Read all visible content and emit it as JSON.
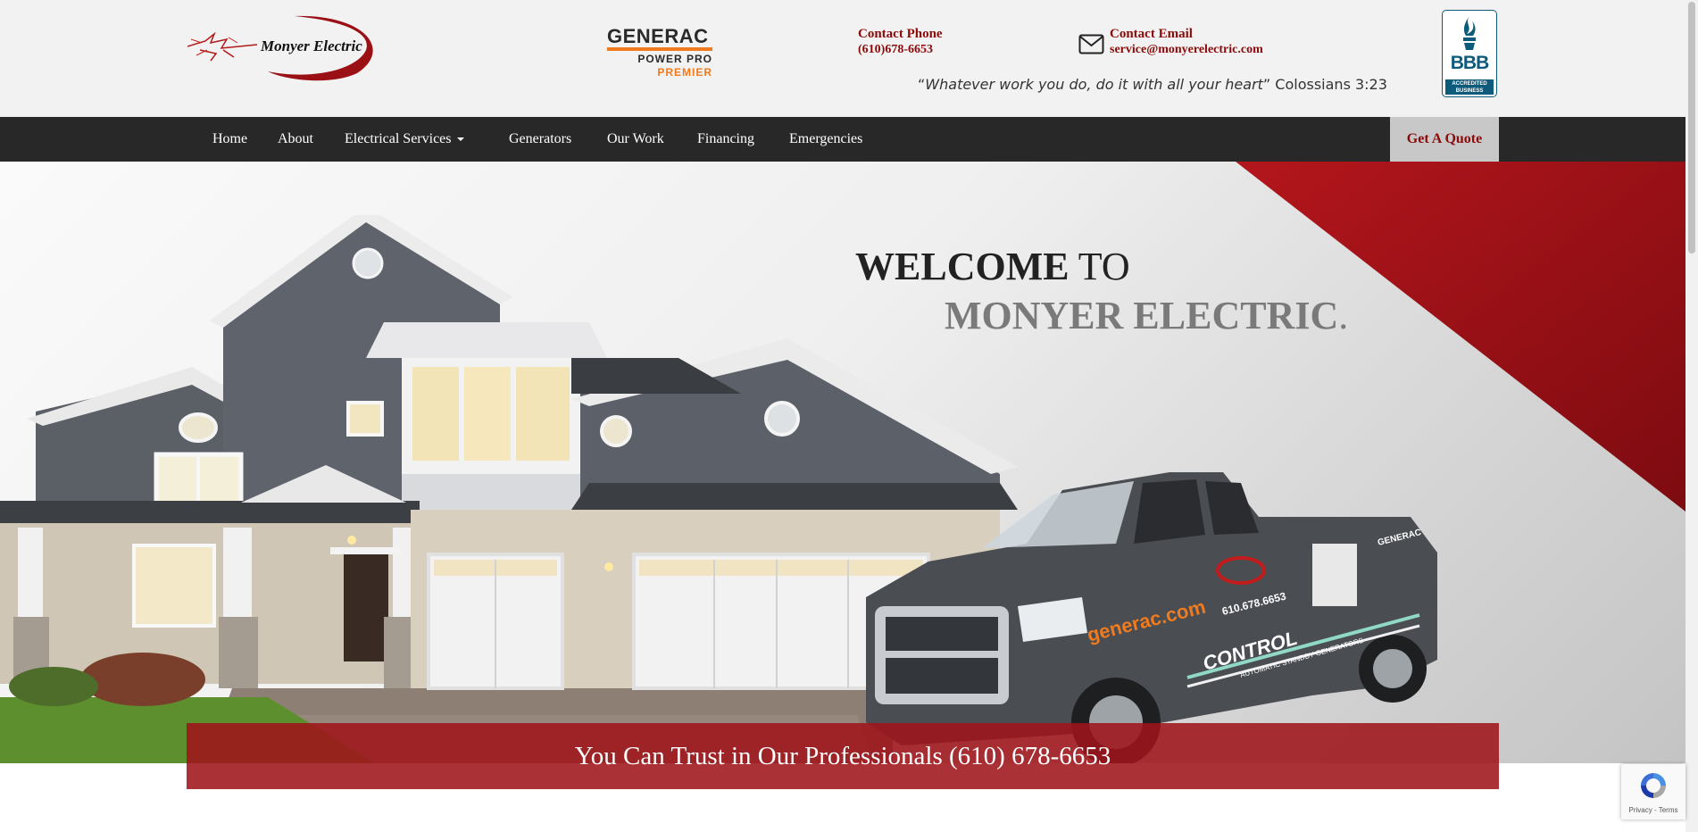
{
  "header": {
    "logo_text": "Monyer Electric",
    "partner": {
      "name": "GENERAC",
      "line2": "POWER PRO",
      "line3": "PREMIER"
    },
    "phone": {
      "label": "Contact Phone",
      "value": "(610)678-6653"
    },
    "email": {
      "label": "Contact Email",
      "value": "service@monyerelectric.com"
    },
    "quote": {
      "open": "“",
      "text": "Whatever work you do, do it with all your heart",
      "close": "”",
      "reference": " Colossians 3:23"
    },
    "bbb": {
      "text": "BBB",
      "band_line1": "ACCREDITED",
      "band_line2": "BUSINESS"
    }
  },
  "nav": {
    "items": [
      {
        "label": "Home"
      },
      {
        "label": "About"
      },
      {
        "label": "Electrical Services"
      },
      {
        "label": "Generators"
      },
      {
        "label": "Our Work"
      },
      {
        "label": "Financing"
      },
      {
        "label": "Emergencies"
      }
    ],
    "cta": "Get A Quote"
  },
  "hero": {
    "welcome_bold": "WELCOME",
    "welcome_rest": " TO",
    "company": "MONYER ELECTRIC",
    "period": ".",
    "banner": "You Can Trust in Our Professionals (610) 678-6653"
  },
  "truck": {
    "brand_text": "generac.com",
    "phone_text": "610.678.6653",
    "slogan": "CONTROL",
    "sub": "AUTOMATIC STANDBY GENERATORS",
    "side_brand": "GENERAC"
  },
  "recaptcha": {
    "links": "Privacy - Terms"
  },
  "colors": {
    "brand_red": "#8b0a0a",
    "nav_bg": "#282828",
    "banner_red": "#9e141a",
    "generac_orange": "#f07b1e",
    "bbb_blue": "#0d5a7a"
  },
  "icons": [
    "mail-icon",
    "caret-down-icon",
    "bbb-torch-icon",
    "recaptcha-icon"
  ]
}
